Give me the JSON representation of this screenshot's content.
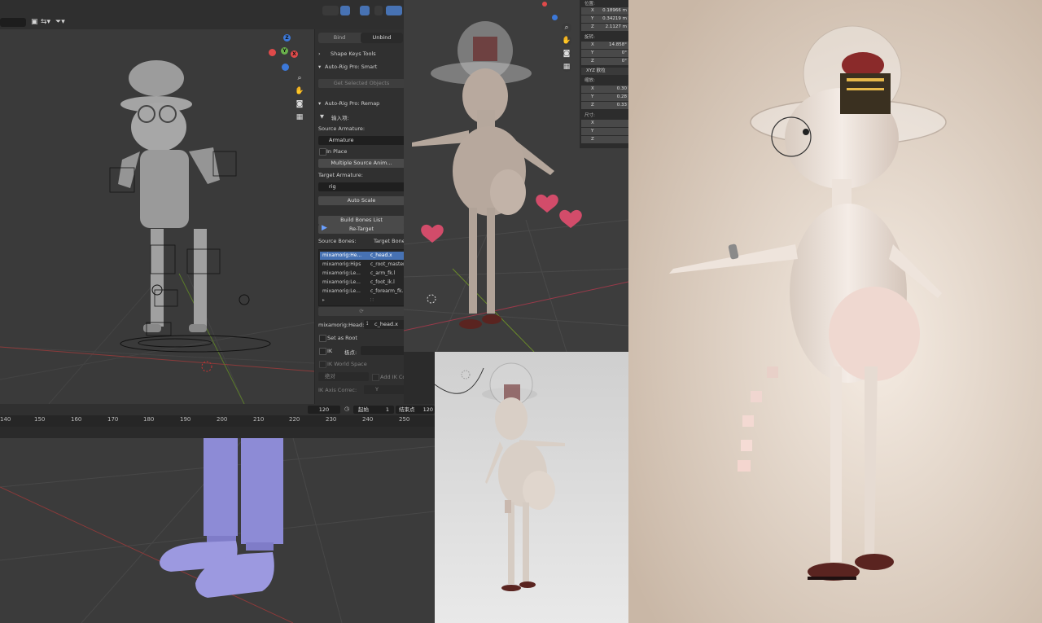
{
  "npanel": {
    "tabs": [
      "Bind",
      "Unbind"
    ],
    "shape_keys_tools": "Shape Keys Tools",
    "arp_smart": "Auto-Rig Pro: Smart",
    "get_selected_objects": "Get Selected Objects",
    "arp_remap": "Auto-Rig Pro: Remap",
    "import_label": "输入项:",
    "source_armature_label": "Source Armature:",
    "source_armature_value": "Armature",
    "in_place": "In Place",
    "multiple_source_anim": "Multiple Source Anim...",
    "target_armature_label": "Target Armature:",
    "target_armature_value": "rig",
    "auto_scale": "Auto Scale",
    "build_bones_list": "Build Bones List",
    "re_target": "Re-Target",
    "source_bones_label": "Source Bones:",
    "target_bones_label": "Target Bones:",
    "bone_rows": [
      {
        "source": "mixamorig:He...",
        "target": "c_head.x"
      },
      {
        "source": "mixamorig:Hips",
        "target": "c_root_master"
      },
      {
        "source": "mixamorig:Le...",
        "target": "c_arm_fk.l"
      },
      {
        "source": "mixamorig:Le...",
        "target": "c_foot_ik.l"
      },
      {
        "source": "mixamorig:Le...",
        "target": "c_forearm_fk..."
      }
    ],
    "selected_bone_source": "mixamorig:Head:",
    "selected_bone_target": "c_head.x",
    "set_as_root": "Set as Root",
    "ik": "IK",
    "pole_label": "极点:",
    "ik_world_space": "IK World Space",
    "absolute": "绝对",
    "add_ik_const": "Add IK Const.",
    "ik_axis_correc": "IK Axis Correc:",
    "ik_axis_value": "Y"
  },
  "timeline": {
    "current_frame": "120",
    "start_label": "起始",
    "start_value": "1",
    "end_label": "结束点",
    "end_value": "120",
    "ticks": [
      "140",
      "150",
      "160",
      "170",
      "180",
      "190",
      "200",
      "210",
      "220",
      "230",
      "240",
      "250"
    ]
  },
  "props": {
    "location_label": "位置:",
    "loc": [
      {
        "k": "X",
        "v": "0.18966 m"
      },
      {
        "k": "Y",
        "v": "0.34219 m"
      },
      {
        "k": "Z",
        "v": "2.1127 m"
      }
    ],
    "rotation_label": "旋转:",
    "rot": [
      {
        "k": "X",
        "v": "14.858°"
      },
      {
        "k": "Y",
        "v": "0°"
      },
      {
        "k": "Z",
        "v": "0°"
      }
    ],
    "euler_mode": "XYZ 欧拉",
    "scale_label": "缩放:",
    "scale": [
      {
        "k": "X",
        "v": "0.30"
      },
      {
        "k": "Y",
        "v": "0.28"
      },
      {
        "k": "Z",
        "v": "0.33"
      }
    ],
    "dims_label": "尺寸:",
    "dims": [
      {
        "k": "X",
        "v": ""
      },
      {
        "k": "Y",
        "v": ""
      },
      {
        "k": "Z",
        "v": ""
      }
    ]
  },
  "gizmo": {
    "x": "X",
    "y": "Y",
    "z": "Z"
  },
  "colors": {
    "selection_blue": "#4772b3",
    "panel_bg": "#303030",
    "viewport_bg": "#3a3a3a"
  }
}
